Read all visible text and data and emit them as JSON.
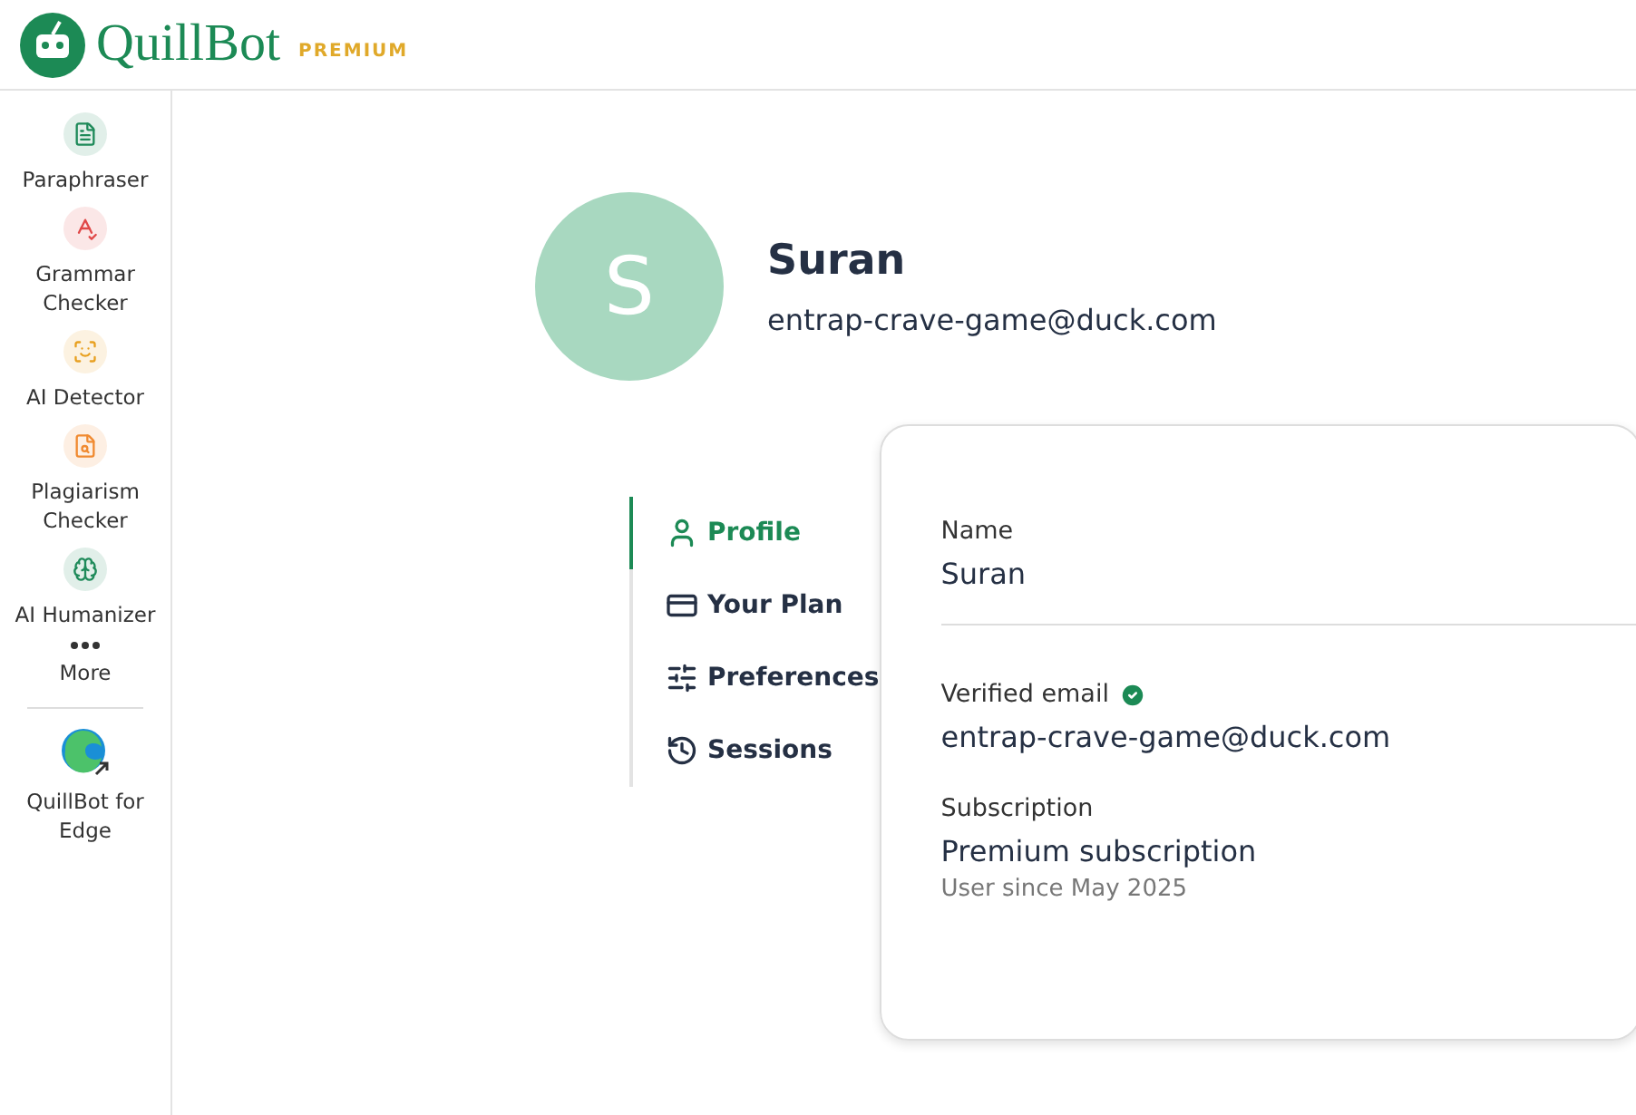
{
  "header": {
    "brand": "QuillBot",
    "badge": "PREMIUM"
  },
  "sidebar": {
    "items": [
      {
        "label": "Paraphraser",
        "kind": "paraphraser",
        "color": "#1f8a5a"
      },
      {
        "label": "Grammar Checker",
        "kind": "grammar",
        "color": "#e04848"
      },
      {
        "label": "AI Detector",
        "kind": "detector",
        "color": "#e8a020"
      },
      {
        "label": "Plagiarism Checker",
        "kind": "plagiarism",
        "color": "#f08a30"
      },
      {
        "label": "AI Humanizer",
        "kind": "humanizer",
        "color": "#1f8a5a"
      },
      {
        "label": "More",
        "kind": "more"
      }
    ],
    "extension": {
      "label": "QuillBot for Edge"
    }
  },
  "profile": {
    "initial": "S",
    "name": "Suran",
    "email": "entrap-crave-game@duck.com"
  },
  "tabs": [
    {
      "label": "Profile",
      "kind": "profile",
      "selected": true
    },
    {
      "label": "Your Plan",
      "kind": "plan",
      "selected": false
    },
    {
      "label": "Preferences",
      "kind": "preferences",
      "selected": false
    },
    {
      "label": "Sessions",
      "kind": "sessions",
      "selected": false
    }
  ],
  "card": {
    "fields": [
      {
        "label": "Name",
        "value": "Suran",
        "divider": true
      },
      {
        "label": "Verified email",
        "value": "entrap-crave-game@duck.com",
        "verified": true
      },
      {
        "label": "Subscription",
        "value": "Premium subscription",
        "note": "User since May 2025"
      }
    ]
  }
}
